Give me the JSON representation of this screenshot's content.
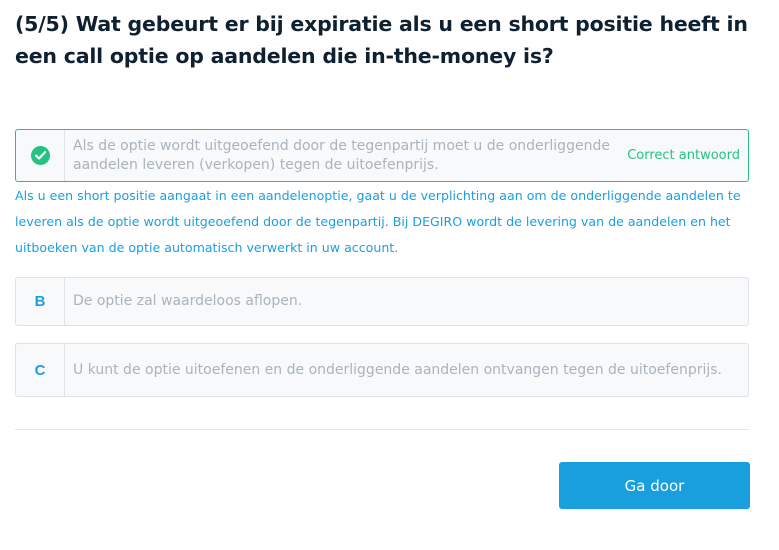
{
  "question": {
    "title": "(5/5) Wat gebeurt er bij expiratie als u een short positie heeft in een call optie op aandelen die in-the-money is?"
  },
  "answers": [
    {
      "marker": "",
      "marker_icon": "check-icon",
      "text": "Als de optie wordt uitgeoefend door de tegenpartij moet u de onderliggende aandelen leveren (verkopen) tegen de uitoefenprijs.",
      "status": "Correct antwoord",
      "state": "correct"
    },
    {
      "marker": "B",
      "text": "De optie zal waardeloos aflopen.",
      "state": "default"
    },
    {
      "marker": "C",
      "text": "U kunt de optie uitoefenen en de onderliggende aandelen ontvangen tegen de uitoefenprijs.",
      "state": "default"
    }
  ],
  "explanation": "Als u een short positie aangaat in een aandelenoptie, gaat u de verplichting aan om de onderliggende aandelen te leveren als de optie wordt uitgeoefend door de tegenpartij. Bij DEGIRO wordt de levering van de aandelen en het uitboeken van de optie automatisch verwerkt in uw account.",
  "footer": {
    "continue_label": "Ga door"
  },
  "colors": {
    "accent": "#1a9fde",
    "correct": "#26c281",
    "title": "#0f2130",
    "muted_text": "#a9b4bd"
  }
}
